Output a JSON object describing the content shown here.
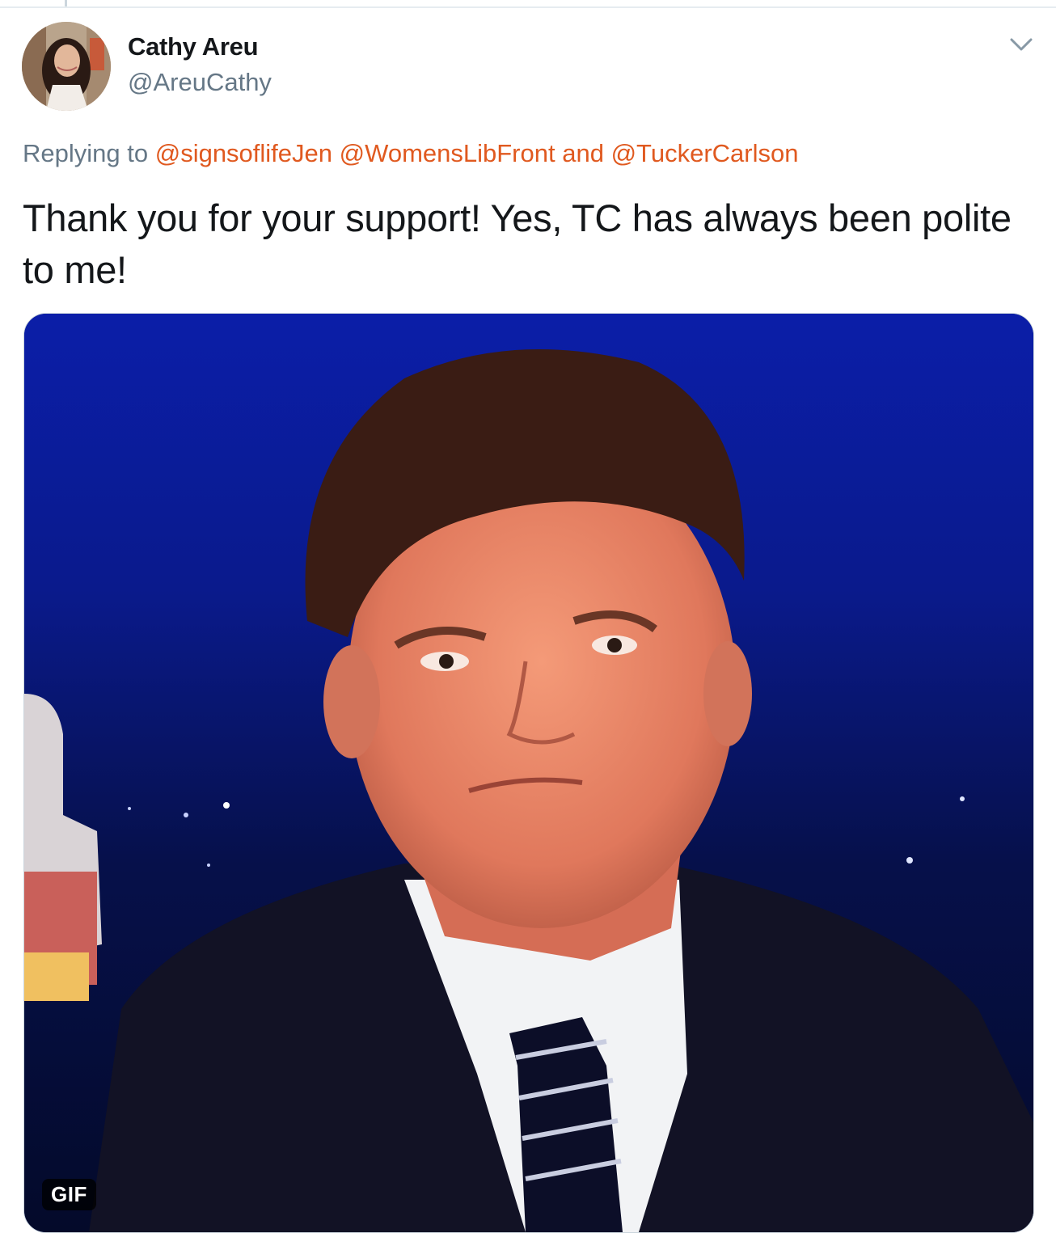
{
  "tweet": {
    "display_name": "Cathy Areu",
    "handle": "@AreuCathy",
    "reply_prefix": "Replying to",
    "mentions": [
      "@signsoflifeJen",
      "@WomensLibFront",
      "@TuckerCarlson"
    ],
    "reply_joiner": "and",
    "text": "Thank you for your support! Yes, TC has always been polite to me!",
    "media_badge": "GIF"
  },
  "icons": {
    "menu": "chevron-down-icon"
  },
  "colors": {
    "link": "#e0591f",
    "secondary_text": "#657786",
    "primary_text": "#14171a"
  }
}
